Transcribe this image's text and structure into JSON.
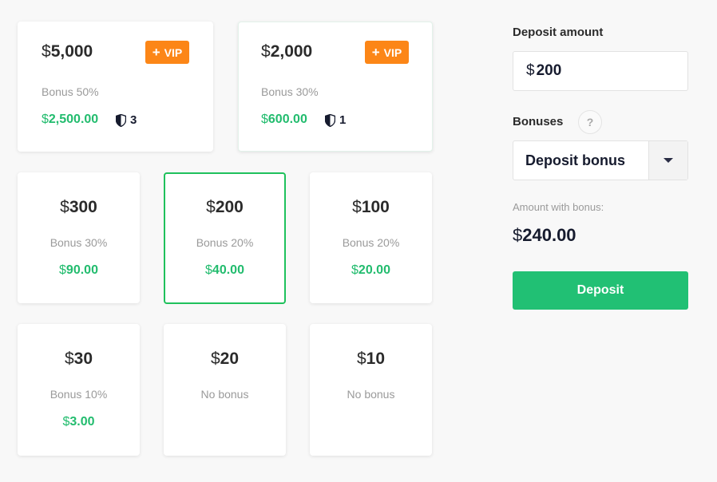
{
  "currency_symbol": "$",
  "vip_packages": [
    {
      "amount": "5,000",
      "badge": "VIP",
      "bonus_label": "Bonus 50%",
      "bonus_amount": "2,500.00",
      "shield_count": "3"
    },
    {
      "amount": "2,000",
      "badge": "VIP",
      "bonus_label": "Bonus 30%",
      "bonus_amount": "600.00",
      "shield_count": "1"
    }
  ],
  "packages": [
    {
      "amount": "300",
      "bonus_label": "Bonus 30%",
      "bonus_amount": "90.00",
      "selected": false
    },
    {
      "amount": "200",
      "bonus_label": "Bonus 20%",
      "bonus_amount": "40.00",
      "selected": true
    },
    {
      "amount": "100",
      "bonus_label": "Bonus 20%",
      "bonus_amount": "20.00",
      "selected": false
    },
    {
      "amount": "30",
      "bonus_label": "Bonus 10%",
      "bonus_amount": "3.00",
      "selected": false
    },
    {
      "amount": "20",
      "bonus_label": "No bonus",
      "bonus_amount": null,
      "selected": false
    },
    {
      "amount": "10",
      "bonus_label": "No bonus",
      "bonus_amount": null,
      "selected": false
    }
  ],
  "panel": {
    "deposit_amount_label": "Deposit amount",
    "deposit_amount_value": "200",
    "bonuses_label": "Bonuses",
    "help_glyph": "?",
    "bonus_select_value": "Deposit bonus",
    "amount_with_bonus_label": "Amount with bonus:",
    "amount_with_bonus_value": "240.00",
    "deposit_button_label": "Deposit"
  },
  "colors": {
    "accent_green": "#22bc6e",
    "selected_border": "#1fc15c",
    "vip_orange": "#fc8617",
    "button_green": "#21c074"
  }
}
